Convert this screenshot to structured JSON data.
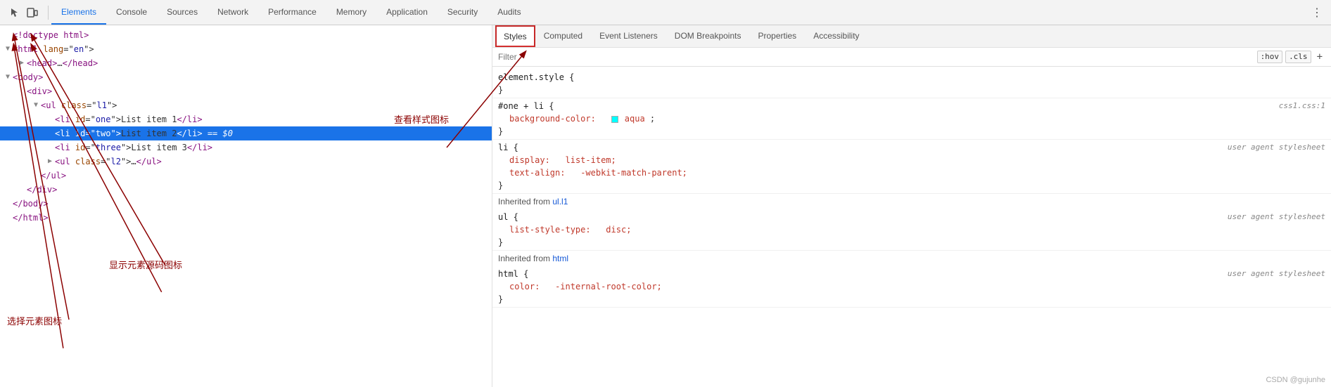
{
  "toolbar": {
    "icons": [
      "select-icon",
      "device-icon"
    ],
    "tabs": [
      {
        "id": "elements",
        "label": "Elements",
        "active": true
      },
      {
        "id": "console",
        "label": "Console",
        "active": false
      },
      {
        "id": "sources",
        "label": "Sources",
        "active": false
      },
      {
        "id": "network",
        "label": "Network",
        "active": false
      },
      {
        "id": "performance",
        "label": "Performance",
        "active": false
      },
      {
        "id": "memory",
        "label": "Memory",
        "active": false
      },
      {
        "id": "application",
        "label": "Application",
        "active": false
      },
      {
        "id": "security",
        "label": "Security",
        "active": false
      },
      {
        "id": "audits",
        "label": "Audits",
        "active": false
      }
    ]
  },
  "dom": {
    "lines": [
      {
        "id": "doctype",
        "indent": 0,
        "html": "<!doctype html>"
      },
      {
        "id": "html-open",
        "indent": 0,
        "html": "<html lang=\"en\">"
      },
      {
        "id": "head",
        "indent": 2,
        "html": "▶<head>…</head>"
      },
      {
        "id": "body-open",
        "indent": 0,
        "html": "▼<body>"
      },
      {
        "id": "div-open",
        "indent": 4,
        "html": "<div>"
      },
      {
        "id": "ul-open",
        "indent": 6,
        "html": "▼<ul class=\"l1\">"
      },
      {
        "id": "li-one",
        "indent": 8,
        "html": "<li id=\"one\">List item 1</li>"
      },
      {
        "id": "li-two",
        "indent": 8,
        "html": "<li id=\"two\">List item 2</li> == $0",
        "selected": true
      },
      {
        "id": "li-three",
        "indent": 8,
        "html": "<li id=\"three\">List item 3</li>"
      },
      {
        "id": "ul2",
        "indent": 8,
        "html": "▶<ul class=\"l2\">…</ul>"
      },
      {
        "id": "ul-close",
        "indent": 6,
        "html": "</ul>"
      },
      {
        "id": "div-close",
        "indent": 4,
        "html": "</div>"
      },
      {
        "id": "body-close",
        "indent": 0,
        "html": "</body>"
      },
      {
        "id": "html-close",
        "indent": 0,
        "html": "</html>"
      }
    ]
  },
  "annotations": {
    "select_label": "选择元素图标",
    "source_label": "显示元素源码图标",
    "styles_label": "查看样式图标"
  },
  "styles_panel": {
    "tabs": [
      {
        "id": "styles",
        "label": "Styles",
        "active": true
      },
      {
        "id": "computed",
        "label": "Computed",
        "active": false
      },
      {
        "id": "event-listeners",
        "label": "Event Listeners",
        "active": false
      },
      {
        "id": "dom-breakpoints",
        "label": "DOM Breakpoints",
        "active": false
      },
      {
        "id": "properties",
        "label": "Properties",
        "active": false
      },
      {
        "id": "accessibility",
        "label": "Accessibility",
        "active": false
      }
    ],
    "filter_placeholder": "Filter",
    "filter_hov": ":hov",
    "filter_cls": ".cls",
    "filter_plus": "+",
    "rules": [
      {
        "id": "element-style",
        "selector": "element.style {",
        "close": "}",
        "props": []
      },
      {
        "id": "one-li",
        "selector": "#one + li {",
        "close": "}",
        "source": "css1.css:1",
        "props": [
          {
            "name": "background-color:",
            "value": "aqua",
            "color_swatch": true
          }
        ]
      },
      {
        "id": "li-rule",
        "selector": "li {",
        "close": "}",
        "source": "user agent stylesheet",
        "props": [
          {
            "name": "display:",
            "value": "list-item;"
          },
          {
            "name": "text-align:",
            "value": "-webkit-match-parent;"
          }
        ]
      },
      {
        "id": "inherited-ul-l1",
        "type": "inherited",
        "text": "Inherited from",
        "link": "ul.l1"
      },
      {
        "id": "ul-rule",
        "selector": "ul {",
        "close": "}",
        "source": "user agent stylesheet",
        "props": [
          {
            "name": "list-style-type:",
            "value": "disc;"
          }
        ]
      },
      {
        "id": "inherited-html",
        "type": "inherited",
        "text": "Inherited from",
        "link": "html"
      },
      {
        "id": "html-rule",
        "selector": "html {",
        "close": "}",
        "source": "user agent stylesheet",
        "props": [
          {
            "name": "color:",
            "value": "-internal-root-color;"
          }
        ]
      }
    ]
  },
  "watermark": "CSDN @gujunhe",
  "colors": {
    "selected_bg": "#1a73e8",
    "tab_active_border": "#d32f2f",
    "prop_color": "#c0392b",
    "arrow_color": "#8b0000",
    "aqua": "#00ffff"
  }
}
